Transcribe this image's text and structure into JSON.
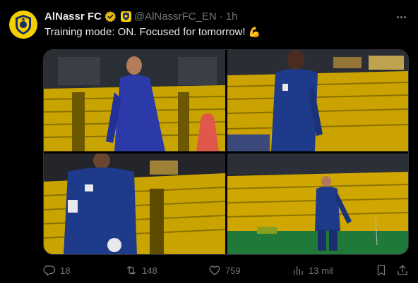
{
  "author": {
    "display_name": "AlNassr FC",
    "handle": "@AlNassrFC_EN",
    "separator": "·",
    "time": "1h",
    "avatar_icon": "alnassr-crest-icon",
    "verified_icon": "gold-verified-badge-icon",
    "affiliate_icon": "alnassr-affiliate-badge-icon"
  },
  "tweet": {
    "text": "Training mode: ON. Focused for tomorrow!",
    "emoji": "💪"
  },
  "media": {
    "photos": [
      {
        "name": "training-photo-1"
      },
      {
        "name": "training-photo-2"
      },
      {
        "name": "training-photo-3"
      },
      {
        "name": "training-photo-4"
      }
    ]
  },
  "actions": {
    "replies": "18",
    "reposts": "148",
    "likes": "759",
    "views": "13 mil"
  },
  "colors": {
    "background": "#000000",
    "text": "#e7e9ea",
    "muted": "#71767b",
    "brand_yellow": "#f5d000",
    "kit_blue": "#1e3a8a"
  }
}
